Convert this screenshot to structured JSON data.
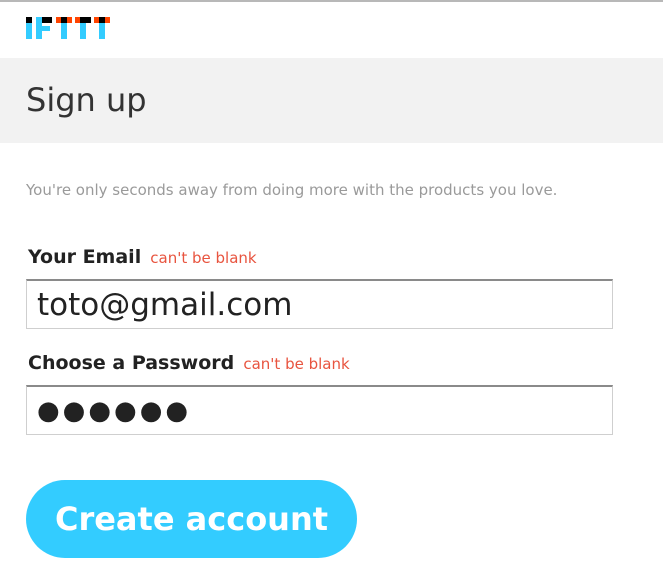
{
  "brand": {
    "logo_text": "IFTTT",
    "colors": {
      "blue": "#33ccff",
      "orange": "#ff4400",
      "black": "#000000"
    }
  },
  "page": {
    "title": "Sign up",
    "tagline": "You're only seconds away from doing more with the products you love."
  },
  "form": {
    "email": {
      "label": "Your Email",
      "error": "can't be blank",
      "value": "toto@gmail.com"
    },
    "password": {
      "label": "Choose a Password",
      "error": "can't be blank",
      "value": "●●●●●●"
    },
    "submit_label": "Create account"
  },
  "colors": {
    "accent": "#33ccff",
    "error": "#e8543f",
    "header_band": "#f2f2f2"
  }
}
